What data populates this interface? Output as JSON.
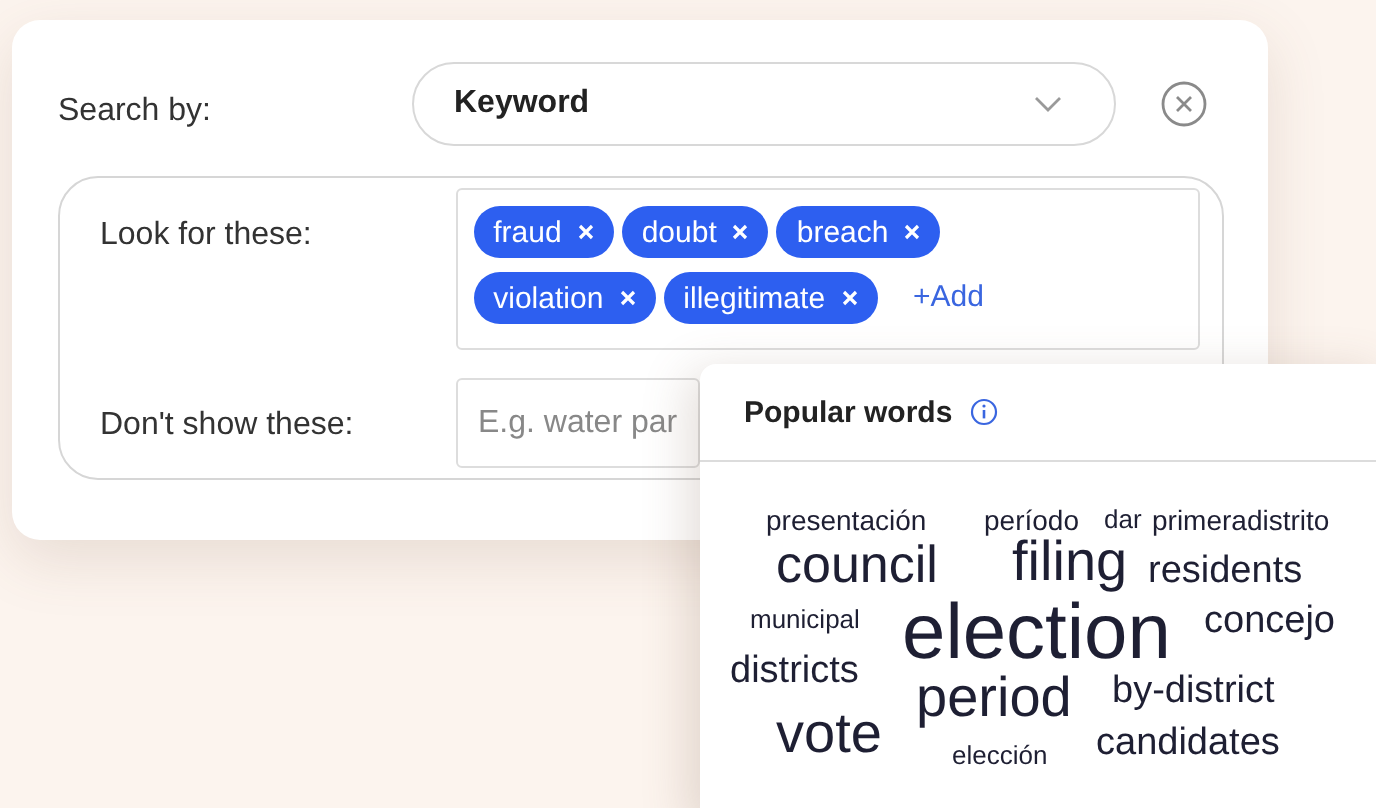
{
  "search_by": {
    "label": "Search by:",
    "value": "Keyword"
  },
  "include": {
    "label": "Look for these:",
    "tags": [
      "fraud",
      "doubt",
      "breach",
      "violation",
      "illegitimate"
    ],
    "add": "+Add"
  },
  "exclude": {
    "label": "Don't show these:",
    "placeholder": "E.g. water par"
  },
  "popular_words": {
    "title": "Popular words",
    "words": [
      "presentación",
      "período",
      "dar",
      "primeradistrito",
      "council",
      "filing",
      "residents",
      "municipal",
      "election",
      "concejo",
      "districts",
      "period",
      "by-district",
      "vote",
      "elección",
      "candidates"
    ]
  }
}
